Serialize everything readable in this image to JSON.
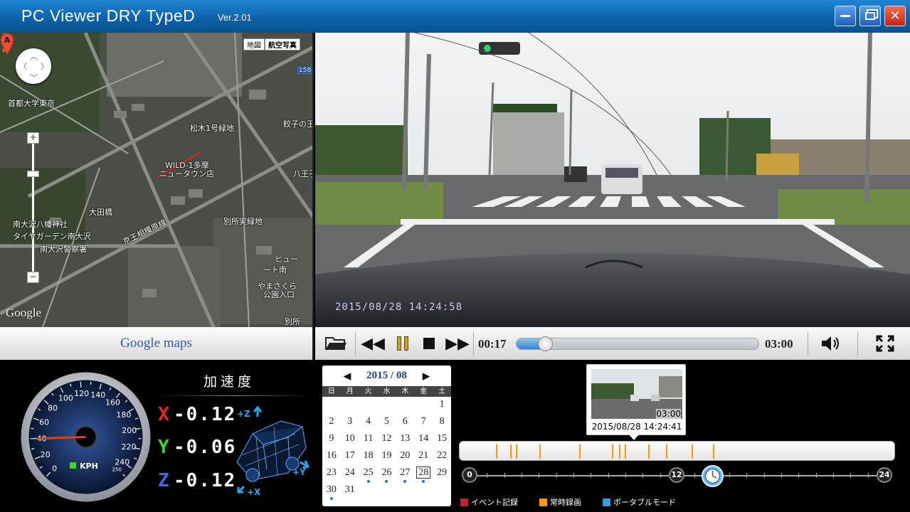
{
  "window": {
    "title": "PC Viewer DRY TypeD",
    "version": "Ver.2.01",
    "min_icon": "minimize-icon",
    "max_icon": "maximize-icon",
    "close_icon": "close-icon"
  },
  "map": {
    "type_buttons": [
      "地図",
      "航空写真"
    ],
    "labels": [
      "首都大学東京",
      "158",
      "松木1号緑地",
      "餃子の王",
      "WILD-1多摩",
      "ニュータウン店",
      "八王子",
      "大田橋",
      "南大沢八幡神社",
      "タイヤガーデン南大沢",
      "京王相模原線",
      "南大沢警察署",
      "別所実緑地",
      "ヒュー",
      "ート南",
      "やまさくら",
      "公園入口",
      "別所"
    ],
    "marker_letter": "A",
    "attribution": "Google",
    "footer_logo": "Google maps"
  },
  "video": {
    "overlay_timestamp": "2015/08/28  14:24:58"
  },
  "controls": {
    "current_time": "00:17",
    "total_time": "03:00",
    "progress": 0.06,
    "icons": [
      "open-folder-icon",
      "rewind-icon",
      "pause-icon",
      "stop-icon",
      "fast-forward-icon",
      "volume-icon",
      "fullscreen-icon"
    ]
  },
  "speedometer": {
    "unit": "KPH",
    "ticks": [
      "0",
      "20",
      "40",
      "60",
      "80",
      "100",
      "120",
      "140",
      "160",
      "180",
      "200",
      "220",
      "240",
      "250"
    ],
    "needle_value": 40
  },
  "acceleration": {
    "title": "加速度",
    "axes": [
      {
        "axis": "X",
        "value": "-0.12",
        "color": "#e8232a"
      },
      {
        "axis": "Y",
        "value": "-0.06",
        "color": "#3fd13a"
      },
      {
        "axis": "Z",
        "value": "-0.12",
        "color": "#3a66e8"
      }
    ],
    "car_labels": [
      "+Z",
      "+Y",
      "+X"
    ]
  },
  "calendar": {
    "month_label": "2015 / 08",
    "prev": "◀",
    "next": "▶",
    "weekdays": [
      "日",
      "月",
      "火",
      "水",
      "木",
      "金",
      "土"
    ],
    "days": [
      "",
      "",
      "",
      "",
      "",
      "",
      "1",
      "2",
      "3",
      "4",
      "5",
      "6",
      "7",
      "8",
      "9",
      "10",
      "11",
      "12",
      "13",
      "14",
      "15",
      "16",
      "17",
      "18",
      "19",
      "20",
      "21",
      "22",
      "23",
      "24",
      "25",
      "26",
      "27",
      "28",
      "29",
      "30",
      "31"
    ],
    "recorded_days": [
      "25",
      "26",
      "27",
      "28",
      "30"
    ],
    "selected_day": "28"
  },
  "timeline": {
    "thumbnail_duration": "03:00",
    "thumbnail_timestamp": "2015/08/28 14:24:41",
    "scale_labels": [
      "0",
      "12",
      "24"
    ],
    "event_hours": [
      2.0,
      2.8,
      3.1,
      4.4,
      6.6,
      8.4,
      8.8,
      9.1,
      10.4,
      11.4,
      12.8,
      14.0
    ],
    "legend": [
      {
        "label": "イベント記録",
        "color": "#cc1f2a"
      },
      {
        "label": "常時録画",
        "color": "#f39a11"
      },
      {
        "label": "ポータブルモード",
        "color": "#2e9fe0"
      }
    ]
  }
}
